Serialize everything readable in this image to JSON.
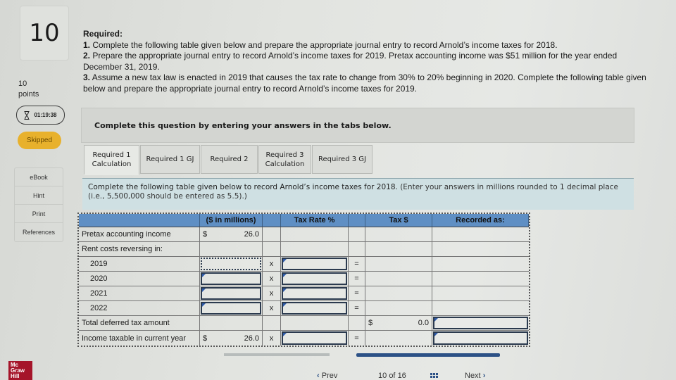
{
  "question": {
    "number": "10",
    "points_value": "10",
    "points_label": "points",
    "timer": "01:19:38",
    "status": "Skipped"
  },
  "tools": [
    "eBook",
    "Hint",
    "Print",
    "References"
  ],
  "brand": {
    "line1": "Mc",
    "line2": "Graw",
    "line3": "Hill",
    "color": "#a5152a"
  },
  "required": {
    "heading": "Required:",
    "items": [
      {
        "num": "1.",
        "text": "Complete the following table given below and prepare the appropriate journal entry to record Arnold’s income taxes for 2018."
      },
      {
        "num": "2.",
        "text": "Prepare the appropriate journal entry to record Arnold’s income taxes for 2019. Pretax accounting income was $51 million for the year ended December 31, 2019."
      },
      {
        "num": "3.",
        "text": "Assume a new tax law is enacted in 2019 that causes the tax rate to change from 30% to 20% beginning in 2020. Complete the following table given below and prepare the appropriate journal entry to record Arnold’s income taxes for 2019."
      }
    ]
  },
  "banner": "Complete this question by entering your answers in the tabs below.",
  "tabs": [
    {
      "line1": "Required 1",
      "line2": "Calculation",
      "active": true
    },
    {
      "line1": "Required 1 GJ",
      "line2": "",
      "active": false
    },
    {
      "line1": "Required 2",
      "line2": "",
      "active": false
    },
    {
      "line1": "Required 3",
      "line2": "Calculation",
      "active": false
    },
    {
      "line1": "Required 3 GJ",
      "line2": "",
      "active": false
    }
  ],
  "instruction": {
    "main": "Complete the following table given below to record Arnold’s income taxes for 2018.",
    "note": "(Enter your answers in millions rounded to 1 decimal place (i.e., 5,500,000 should be entered as 5.5).)"
  },
  "table": {
    "headers": {
      "label": "",
      "amount": "($ in millions)",
      "rate": "Tax Rate %",
      "tax": "Tax $",
      "recorded": "Recorded as:"
    },
    "header_color": "#5f8fc4",
    "rows": {
      "pretax": {
        "label": "Pretax accounting income",
        "currency": "$",
        "amount": "26.0"
      },
      "rent": {
        "label": "Rent costs reversing in:"
      },
      "y2019": {
        "label": "2019",
        "amount": "",
        "op1": "x",
        "rate": "",
        "op2": "="
      },
      "y2020": {
        "label": "2020",
        "amount": "",
        "op1": "x",
        "rate": "",
        "op2": "="
      },
      "y2021": {
        "label": "2021",
        "amount": "",
        "op1": "x",
        "rate": "",
        "op2": "="
      },
      "y2022": {
        "label": "2022",
        "amount": "",
        "op1": "x",
        "rate": "",
        "op2": "="
      },
      "total_deferred": {
        "label": "Total deferred tax amount",
        "currency": "$",
        "tax": "0.0",
        "recorded": ""
      },
      "taxable": {
        "label": "Income taxable in current year",
        "currency": "$",
        "amount": "26.0",
        "op1": "x",
        "rate": "",
        "op2": "=",
        "recorded": ""
      }
    }
  },
  "pagination": {
    "prev": "Prev",
    "current": "10",
    "of": "of",
    "total": "16",
    "next": "Next"
  }
}
